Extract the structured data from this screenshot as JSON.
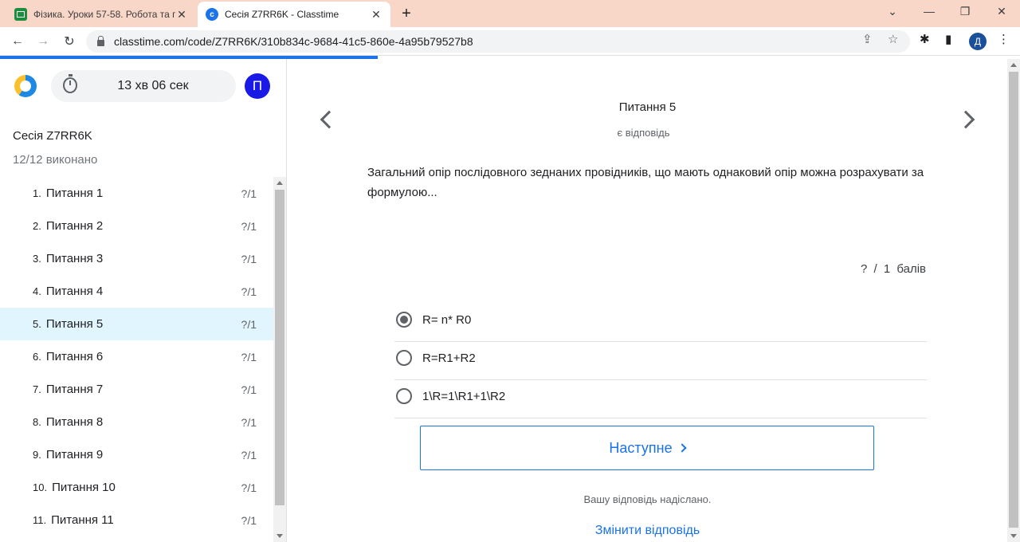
{
  "browser": {
    "tabs": [
      {
        "title": "Фізика. Уроки 57-58. Робота та п",
        "close": "✕"
      },
      {
        "title": "Сесія Z7RR6K - Classtime",
        "close": "✕"
      }
    ],
    "new_tab": "+",
    "window_controls": {
      "tab_search": "⌄",
      "minimize": "—",
      "restore": "❐",
      "close": "✕"
    },
    "nav": {
      "back": "←",
      "forward": "→",
      "reload": "↻"
    },
    "url": "classtime.com/code/Z7RR6K/310b834c-9684-41c5-860e-4a95b79527b8",
    "toolbar_icons": {
      "share": "⇪",
      "star": "☆",
      "extensions": "✱",
      "sidepanel": "▮",
      "menu": "⋮"
    },
    "profile_initial": "Д",
    "favicon_ct": "c"
  },
  "sidebar": {
    "timer": "13 хв 06 сек",
    "user_initial": "П",
    "session_title": "Сесія Z7RR6K",
    "completed": "12/12 виконано",
    "questions": [
      {
        "num": "1.",
        "label": "Питання 1",
        "score": "?/1"
      },
      {
        "num": "2.",
        "label": "Питання 2",
        "score": "?/1"
      },
      {
        "num": "3.",
        "label": "Питання 3",
        "score": "?/1"
      },
      {
        "num": "4.",
        "label": "Питання 4",
        "score": "?/1"
      },
      {
        "num": "5.",
        "label": "Питання 5",
        "score": "?/1"
      },
      {
        "num": "6.",
        "label": "Питання 6",
        "score": "?/1"
      },
      {
        "num": "7.",
        "label": "Питання 7",
        "score": "?/1"
      },
      {
        "num": "8.",
        "label": "Питання 8",
        "score": "?/1"
      },
      {
        "num": "9.",
        "label": "Питання 9",
        "score": "?/1"
      },
      {
        "num": "10.",
        "label": "Питання 10",
        "score": "?/1"
      },
      {
        "num": "11.",
        "label": "Питання 11",
        "score": "?/1"
      }
    ]
  },
  "main": {
    "question_number": "Питання 5",
    "status": "є відповідь",
    "question_text": "Загальний опір послідовного зеднаних провідників, що мають однаковий опір можна розрахувати за формулою...",
    "points": "? / 1 балів",
    "options": [
      {
        "label": "R= n* R0",
        "selected": true
      },
      {
        "label": "R=R1+R2",
        "selected": false
      },
      {
        "label": "1\\R=1\\R1+1\\R2",
        "selected": false
      }
    ],
    "next_label": "Наступне",
    "sent_message": "Вашу відповідь надіслано.",
    "change_answer": "Змінити відповідь"
  }
}
